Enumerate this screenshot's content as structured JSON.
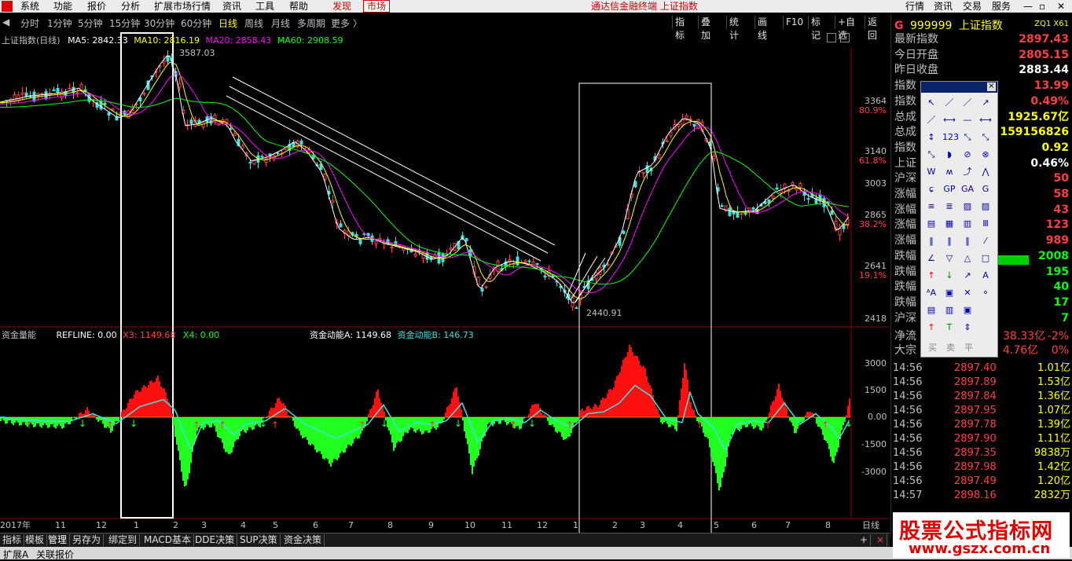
{
  "menubar": {
    "items": [
      "系统",
      "功能",
      "报价",
      "分析",
      "扩展市场行情",
      "资讯",
      "工具",
      "帮助"
    ],
    "tabs": [
      "发现",
      "市场"
    ],
    "title": "通达信金融终端 上证指数",
    "right_items": [
      "行情",
      "资讯",
      "交易",
      "服务"
    ]
  },
  "periods": [
    "分时",
    "1分钟",
    "5分钟",
    "15分钟",
    "30分钟",
    "60分钟",
    "日线",
    "周线",
    "月线",
    "多周期",
    "更多 〉"
  ],
  "active_period": "日线",
  "toolbar": [
    "指标",
    "叠加",
    "统计",
    "画线",
    "F10",
    "标记",
    "+自选",
    "返回"
  ],
  "main_chart": {
    "title": "上证指数(日线)",
    "ma": [
      {
        "name": "MA5",
        "value": "2842.33",
        "color": "#ffffff"
      },
      {
        "name": "MA10",
        "value": "2816.19",
        "color": "#ffff00"
      },
      {
        "name": "MA20",
        "value": "2858.43",
        "color": "#ff00ff"
      },
      {
        "name": "MA60",
        "value": "2908.59",
        "color": "#00ff00"
      }
    ],
    "high_label": "3587.03",
    "low_label": "2440.91",
    "y_ticks": [
      "3364",
      "3140",
      "3003",
      "2865",
      "2641",
      "2418"
    ],
    "y_pct": [
      "80.9%",
      "61.8%",
      "38.2%",
      "19.1%"
    ]
  },
  "sub_chart": {
    "title": "资金量能",
    "refline": "REFLINE: 0.00",
    "x3": "X3: 1149.68",
    "x4": "X4: 0.00",
    "a": "资金动能A: 1149.68",
    "b": "资金动能B: 146.73",
    "y_ticks": [
      "3000",
      "1500",
      "0.00",
      "-1500",
      "-3000"
    ]
  },
  "x_axis": {
    "labels": [
      "2017年",
      "11",
      "12",
      "1",
      "2",
      "3",
      "4",
      "5",
      "6",
      "7",
      "8",
      "9",
      "10",
      "11",
      "12",
      "1",
      "2",
      "3",
      "4",
      "5",
      "6",
      "7",
      "8"
    ],
    "unit": "日线"
  },
  "right_panel": {
    "code": "999999",
    "name": "上证指数",
    "tag": "ZQ1 X61",
    "prefix": "G",
    "rows": [
      {
        "label": "最新指数",
        "value": "2897.43",
        "color": "#ff4040"
      },
      {
        "label": "今日开盘",
        "value": "2805.15",
        "color": "#ff4040"
      },
      {
        "label": "昨日收盘",
        "value": "2883.44",
        "color": "#ffffff"
      },
      {
        "label": "指数",
        "value": "13.99",
        "color": "#ff4040"
      },
      {
        "label": "指数",
        "value": "0.49%",
        "color": "#ff4040"
      },
      {
        "label": "总成",
        "value": "1925.67亿",
        "color": "#ffff00"
      },
      {
        "label": "总成",
        "value": "159156826",
        "color": "#ffff00"
      },
      {
        "label": "指数",
        "value": "0.92",
        "color": "#ffff00"
      },
      {
        "label": "上证",
        "value": "0.46%",
        "color": "#ffffff"
      },
      {
        "label": "沪深",
        "value": "50",
        "color": "#ff4040"
      },
      {
        "label": "涨幅",
        "value": "58",
        "color": "#ff4040"
      },
      {
        "label": "涨幅",
        "value": "43",
        "color": "#ff4040"
      },
      {
        "label": "涨幅",
        "value": "123",
        "color": "#ff4040"
      },
      {
        "label": "涨幅",
        "value": "989",
        "color": "#ff4040"
      },
      {
        "label": "跌幅",
        "value": "2008",
        "color": "#00ff00"
      },
      {
        "label": "跌幅",
        "value": "195",
        "color": "#00ff00"
      },
      {
        "label": "跌幅",
        "value": "40",
        "color": "#00ff00"
      },
      {
        "label": "跌幅",
        "value": "17",
        "color": "#00ff00"
      },
      {
        "label": "沪深",
        "value": "7",
        "color": "#00ff00"
      }
    ],
    "flow": [
      {
        "label": "净流",
        "value": "38.33亿",
        "pct": "-2%"
      },
      {
        "label": "大宗",
        "value": "4.76亿",
        "pct": "0%"
      }
    ],
    "ticks": [
      {
        "time": "14:56",
        "price": "2897.40",
        "vol": "1.01亿"
      },
      {
        "time": "14:56",
        "price": "2897.89",
        "vol": "1.53亿"
      },
      {
        "time": "14:56",
        "price": "2897.84",
        "vol": "1.36亿"
      },
      {
        "time": "14:56",
        "price": "2897.95",
        "vol": "1.07亿"
      },
      {
        "time": "14:56",
        "price": "2897.78",
        "vol": "1.39亿"
      },
      {
        "time": "14:56",
        "price": "2897.90",
        "vol": "1.11亿"
      },
      {
        "time": "14:56",
        "price": "2897.35",
        "vol": "9838万"
      },
      {
        "time": "14:56",
        "price": "2897.98",
        "vol": "1.42亿"
      },
      {
        "time": "14:56",
        "price": "2897.49",
        "vol": "1.20亿"
      },
      {
        "time": "14:57",
        "price": "2898.16",
        "vol": "2832万"
      }
    ]
  },
  "palette": {
    "buy": "买",
    "sell": "卖",
    "flat": "平",
    "glyphs": [
      "↖",
      "／",
      "／",
      "↗",
      "／",
      "⟷",
      "—",
      "⟷",
      "↕",
      "123",
      "⤡",
      "⤡",
      "⤡",
      "◗",
      "⊘",
      "⊗",
      "W",
      "ʍ",
      "⤴",
      "⋀",
      "ɕ",
      "GP",
      "GA",
      "G",
      "≡",
      "≣",
      "▨",
      "▨",
      "▤",
      "▦",
      "▥",
      "Ⅲ",
      "‖",
      "‖",
      "‖",
      "⁄",
      "∠",
      "▽",
      "△",
      "□",
      "↑",
      "↓",
      "↗",
      "A",
      "ᴬA",
      "▣",
      "✕",
      "⚬",
      "▤",
      "▥",
      "▣",
      "",
      "↑",
      "T",
      "⇕",
      ""
    ]
  },
  "bottom_tabs": [
    "指标",
    "模板",
    "管理",
    "另存为",
    "绑定到",
    "MACD基本",
    "DDE决策",
    "SUP决策",
    "资金决策"
  ],
  "bottom_right": [
    "+",
    "×"
  ],
  "status": [
    "扩展A",
    "关联报价"
  ],
  "watermark": {
    "line1": "股票公式指标网",
    "line2": "www.gszx.com.cn"
  }
}
